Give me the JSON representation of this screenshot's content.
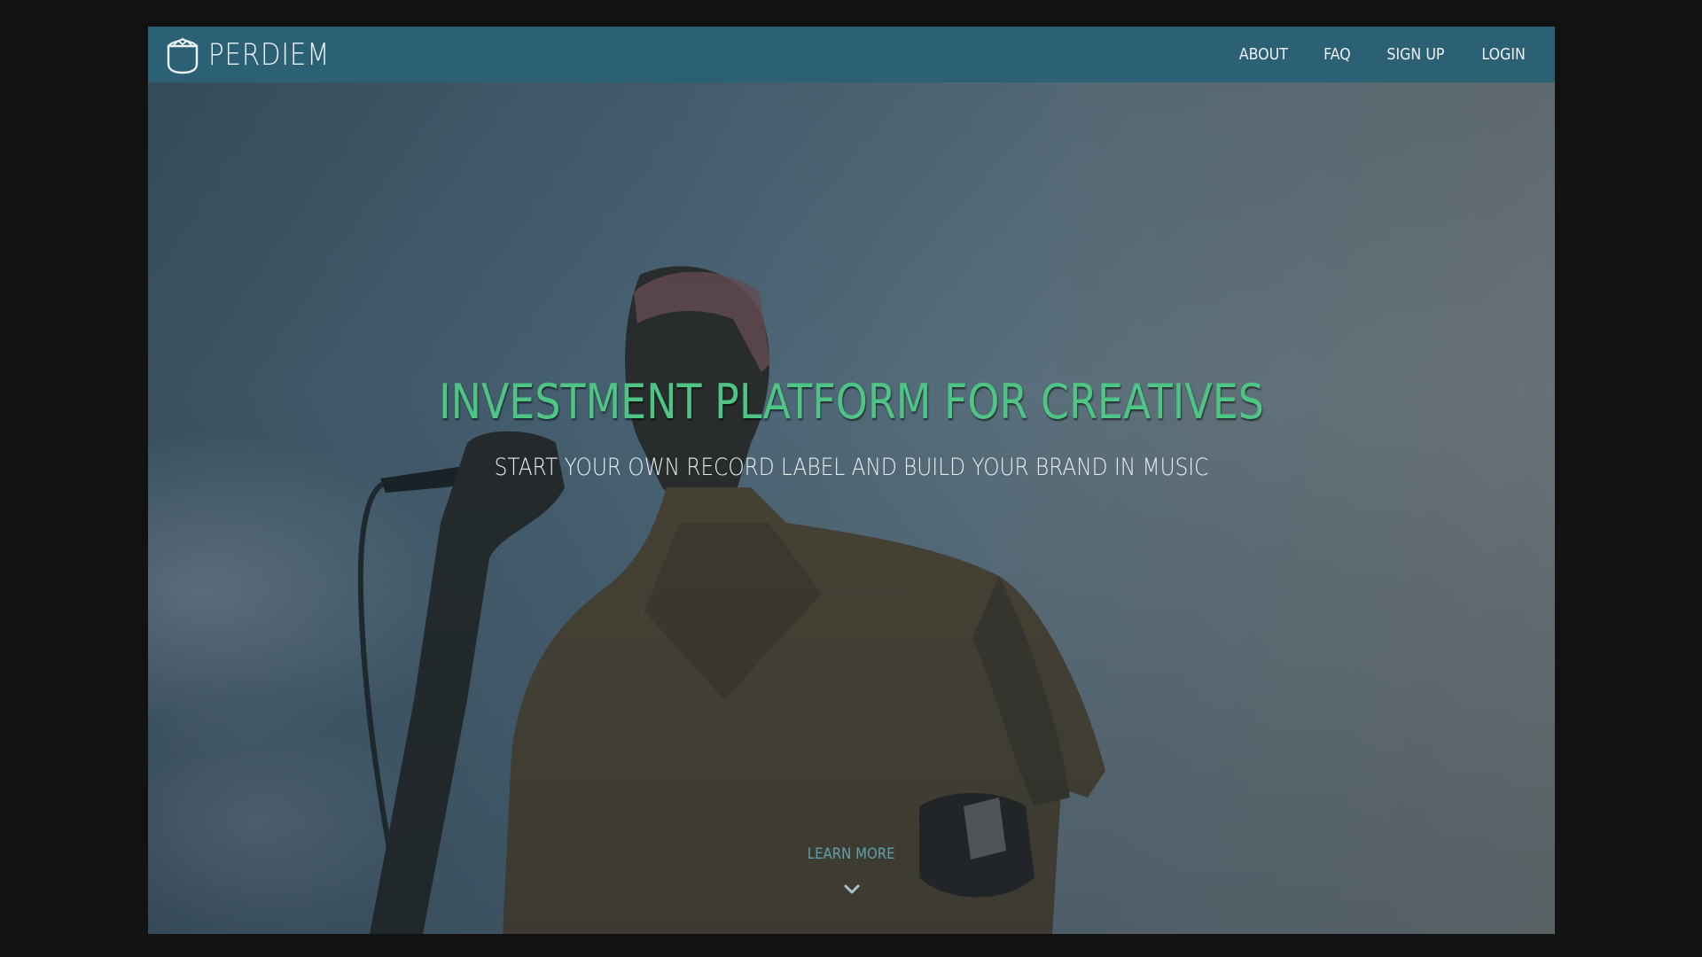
{
  "brand": {
    "name": "PERDIEM",
    "icon": "pocket-logo-icon"
  },
  "nav": {
    "items": [
      {
        "label": "ABOUT"
      },
      {
        "label": "FAQ"
      },
      {
        "label": "SIGN UP"
      },
      {
        "label": "LOGIN"
      }
    ]
  },
  "hero": {
    "headline": "INVESTMENT PLATFORM FOR CREATIVES",
    "subheadline": "START YOUR OWN RECORD LABEL AND BUILD YOUR BRAND IN MUSIC",
    "learn_more_label": "LEARN MORE",
    "learn_more_icon": "chevron-down-icon"
  },
  "colors": {
    "navbar": "#2b6075",
    "headline": "#4ec585",
    "learn_more": "#5fa0ae",
    "outer_background": "#121212"
  }
}
